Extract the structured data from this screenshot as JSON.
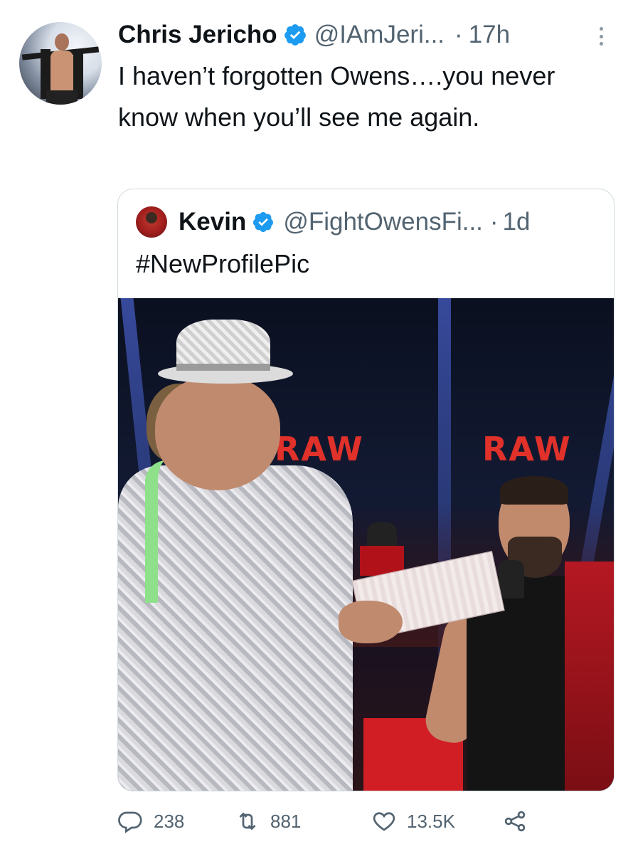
{
  "tweet": {
    "author_name": "Chris Jericho",
    "author_handle": "@IAmJeri...",
    "time_separator": "·",
    "time": "17h",
    "text": "I haven’t forgotten Owens….you never know when you’ll see me again.",
    "avatar_icon": "profile-photo",
    "verified_icon": "verified-badge-icon",
    "more_icon": "more-vertical-icon"
  },
  "quote": {
    "author_name": "Kevin",
    "author_handle": "@FightOwensFi...",
    "time_separator": "·",
    "time": "1d",
    "text": "#NewProfilePic",
    "image_signage": [
      "RAW",
      "RAW"
    ]
  },
  "actions": {
    "reply_count": "238",
    "retweet_count": "881",
    "like_count": "13.5K"
  },
  "colors": {
    "text_primary": "#0f1419",
    "text_secondary": "#536471",
    "verified_blue": "#1d9bf0",
    "border": "#cfd9de"
  }
}
